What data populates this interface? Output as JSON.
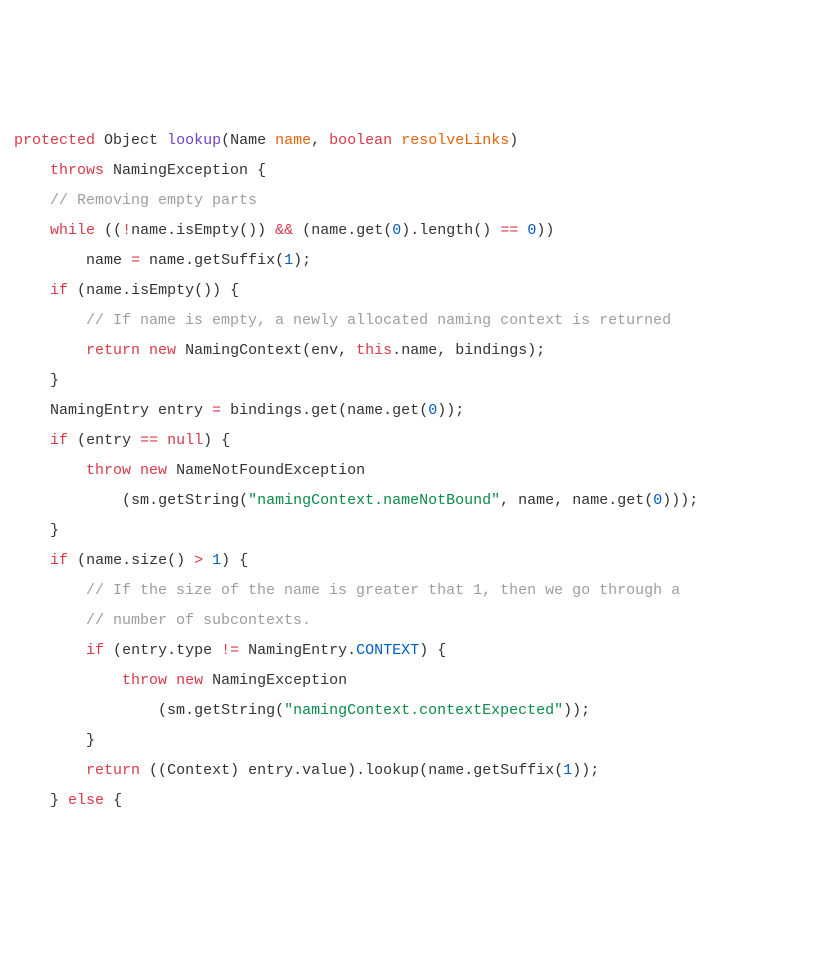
{
  "code": {
    "lines": [
      {
        "indent": 0,
        "tokens": [
          {
            "cls": "tok-keyword",
            "t": "protected"
          },
          {
            "cls": "tok-plain",
            "t": " "
          },
          {
            "cls": "tok-type",
            "t": "Object"
          },
          {
            "cls": "tok-plain",
            "t": " "
          },
          {
            "cls": "tok-methoddef",
            "t": "lookup"
          },
          {
            "cls": "tok-punct",
            "t": "("
          },
          {
            "cls": "tok-type",
            "t": "Name"
          },
          {
            "cls": "tok-plain",
            "t": " "
          },
          {
            "cls": "tok-param",
            "t": "name"
          },
          {
            "cls": "tok-punct",
            "t": ", "
          },
          {
            "cls": "tok-keyword",
            "t": "boolean"
          },
          {
            "cls": "tok-plain",
            "t": " "
          },
          {
            "cls": "tok-param",
            "t": "resolveLinks"
          },
          {
            "cls": "tok-punct",
            "t": ")"
          }
        ]
      },
      {
        "indent": 1,
        "tokens": [
          {
            "cls": "tok-keyword",
            "t": "throws"
          },
          {
            "cls": "tok-plain",
            "t": " NamingException "
          },
          {
            "cls": "tok-punct",
            "t": "{"
          }
        ]
      },
      {
        "indent": 0,
        "tokens": [
          {
            "cls": "tok-plain",
            "t": ""
          }
        ]
      },
      {
        "indent": 1,
        "tokens": [
          {
            "cls": "tok-comment",
            "t": "// Removing empty parts"
          }
        ]
      },
      {
        "indent": 1,
        "tokens": [
          {
            "cls": "tok-keyword",
            "t": "while"
          },
          {
            "cls": "tok-plain",
            "t": " "
          },
          {
            "cls": "tok-punct",
            "t": "(("
          },
          {
            "cls": "tok-op",
            "t": "!"
          },
          {
            "cls": "tok-plain",
            "t": "name"
          },
          {
            "cls": "tok-punct",
            "t": "."
          },
          {
            "cls": "tok-callmethod",
            "t": "isEmpty"
          },
          {
            "cls": "tok-punct",
            "t": "()) "
          },
          {
            "cls": "tok-op",
            "t": "&&"
          },
          {
            "cls": "tok-plain",
            "t": " "
          },
          {
            "cls": "tok-punct",
            "t": "("
          },
          {
            "cls": "tok-plain",
            "t": "name"
          },
          {
            "cls": "tok-punct",
            "t": "."
          },
          {
            "cls": "tok-callmethod",
            "t": "get"
          },
          {
            "cls": "tok-punct",
            "t": "("
          },
          {
            "cls": "tok-number",
            "t": "0"
          },
          {
            "cls": "tok-punct",
            "t": ")."
          },
          {
            "cls": "tok-callmethod",
            "t": "length"
          },
          {
            "cls": "tok-punct",
            "t": "() "
          },
          {
            "cls": "tok-op",
            "t": "=="
          },
          {
            "cls": "tok-plain",
            "t": " "
          },
          {
            "cls": "tok-number",
            "t": "0"
          },
          {
            "cls": "tok-punct",
            "t": "))"
          }
        ]
      },
      {
        "indent": 2,
        "tokens": [
          {
            "cls": "tok-plain",
            "t": "name "
          },
          {
            "cls": "tok-op",
            "t": "="
          },
          {
            "cls": "tok-plain",
            "t": " name"
          },
          {
            "cls": "tok-punct",
            "t": "."
          },
          {
            "cls": "tok-callmethod",
            "t": "getSuffix"
          },
          {
            "cls": "tok-punct",
            "t": "("
          },
          {
            "cls": "tok-number",
            "t": "1"
          },
          {
            "cls": "tok-punct",
            "t": ");"
          }
        ]
      },
      {
        "indent": 1,
        "tokens": [
          {
            "cls": "tok-keyword",
            "t": "if"
          },
          {
            "cls": "tok-plain",
            "t": " "
          },
          {
            "cls": "tok-punct",
            "t": "("
          },
          {
            "cls": "tok-plain",
            "t": "name"
          },
          {
            "cls": "tok-punct",
            "t": "."
          },
          {
            "cls": "tok-callmethod",
            "t": "isEmpty"
          },
          {
            "cls": "tok-punct",
            "t": "()) {"
          }
        ]
      },
      {
        "indent": 2,
        "tokens": [
          {
            "cls": "tok-comment",
            "t": "// If name is empty, a newly allocated naming context is returned"
          }
        ]
      },
      {
        "indent": 2,
        "tokens": [
          {
            "cls": "tok-keyword",
            "t": "return"
          },
          {
            "cls": "tok-plain",
            "t": " "
          },
          {
            "cls": "tok-keyword",
            "t": "new"
          },
          {
            "cls": "tok-plain",
            "t": " "
          },
          {
            "cls": "tok-callmethod",
            "t": "NamingContext"
          },
          {
            "cls": "tok-punct",
            "t": "("
          },
          {
            "cls": "tok-plain",
            "t": "env"
          },
          {
            "cls": "tok-punct",
            "t": ", "
          },
          {
            "cls": "tok-keyword",
            "t": "this"
          },
          {
            "cls": "tok-punct",
            "t": "."
          },
          {
            "cls": "tok-plain",
            "t": "name"
          },
          {
            "cls": "tok-punct",
            "t": ", "
          },
          {
            "cls": "tok-plain",
            "t": "bindings"
          },
          {
            "cls": "tok-punct",
            "t": ");"
          }
        ]
      },
      {
        "indent": 1,
        "tokens": [
          {
            "cls": "tok-punct",
            "t": "}"
          }
        ]
      },
      {
        "indent": 0,
        "tokens": [
          {
            "cls": "tok-plain",
            "t": ""
          }
        ]
      },
      {
        "indent": 1,
        "tokens": [
          {
            "cls": "tok-type",
            "t": "NamingEntry"
          },
          {
            "cls": "tok-plain",
            "t": " entry "
          },
          {
            "cls": "tok-op",
            "t": "="
          },
          {
            "cls": "tok-plain",
            "t": " bindings"
          },
          {
            "cls": "tok-punct",
            "t": "."
          },
          {
            "cls": "tok-callmethod",
            "t": "get"
          },
          {
            "cls": "tok-punct",
            "t": "("
          },
          {
            "cls": "tok-plain",
            "t": "name"
          },
          {
            "cls": "tok-punct",
            "t": "."
          },
          {
            "cls": "tok-callmethod",
            "t": "get"
          },
          {
            "cls": "tok-punct",
            "t": "("
          },
          {
            "cls": "tok-number",
            "t": "0"
          },
          {
            "cls": "tok-punct",
            "t": "));"
          }
        ]
      },
      {
        "indent": 0,
        "tokens": [
          {
            "cls": "tok-plain",
            "t": ""
          }
        ]
      },
      {
        "indent": 1,
        "tokens": [
          {
            "cls": "tok-keyword",
            "t": "if"
          },
          {
            "cls": "tok-plain",
            "t": " "
          },
          {
            "cls": "tok-punct",
            "t": "("
          },
          {
            "cls": "tok-plain",
            "t": "entry "
          },
          {
            "cls": "tok-op",
            "t": "=="
          },
          {
            "cls": "tok-plain",
            "t": " "
          },
          {
            "cls": "tok-keyword",
            "t": "null"
          },
          {
            "cls": "tok-punct",
            "t": ") {"
          }
        ]
      },
      {
        "indent": 2,
        "tokens": [
          {
            "cls": "tok-keyword",
            "t": "throw"
          },
          {
            "cls": "tok-plain",
            "t": " "
          },
          {
            "cls": "tok-keyword",
            "t": "new"
          },
          {
            "cls": "tok-plain",
            "t": " "
          },
          {
            "cls": "tok-callmethod",
            "t": "NameNotFoundException"
          }
        ]
      },
      {
        "indent": 3,
        "tokens": [
          {
            "cls": "tok-punct",
            "t": "("
          },
          {
            "cls": "tok-plain",
            "t": "sm"
          },
          {
            "cls": "tok-punct",
            "t": "."
          },
          {
            "cls": "tok-callmethod",
            "t": "getString"
          },
          {
            "cls": "tok-punct",
            "t": "("
          },
          {
            "cls": "tok-string",
            "t": "\"namingContext.nameNotBound\""
          },
          {
            "cls": "tok-punct",
            "t": ", "
          },
          {
            "cls": "tok-plain",
            "t": "name"
          },
          {
            "cls": "tok-punct",
            "t": ", "
          },
          {
            "cls": "tok-plain",
            "t": "name"
          },
          {
            "cls": "tok-punct",
            "t": "."
          },
          {
            "cls": "tok-callmethod",
            "t": "get"
          },
          {
            "cls": "tok-punct",
            "t": "("
          },
          {
            "cls": "tok-number",
            "t": "0"
          },
          {
            "cls": "tok-punct",
            "t": ")));"
          }
        ]
      },
      {
        "indent": 1,
        "tokens": [
          {
            "cls": "tok-punct",
            "t": "}"
          }
        ]
      },
      {
        "indent": 0,
        "tokens": [
          {
            "cls": "tok-plain",
            "t": ""
          }
        ]
      },
      {
        "indent": 1,
        "tokens": [
          {
            "cls": "tok-keyword",
            "t": "if"
          },
          {
            "cls": "tok-plain",
            "t": " "
          },
          {
            "cls": "tok-punct",
            "t": "("
          },
          {
            "cls": "tok-plain",
            "t": "name"
          },
          {
            "cls": "tok-punct",
            "t": "."
          },
          {
            "cls": "tok-callmethod",
            "t": "size"
          },
          {
            "cls": "tok-punct",
            "t": "() "
          },
          {
            "cls": "tok-op",
            "t": ">"
          },
          {
            "cls": "tok-plain",
            "t": " "
          },
          {
            "cls": "tok-number",
            "t": "1"
          },
          {
            "cls": "tok-punct",
            "t": ") {"
          }
        ]
      },
      {
        "indent": 2,
        "tokens": [
          {
            "cls": "tok-comment",
            "t": "// If the size of the name is greater that 1, then we go through a"
          }
        ]
      },
      {
        "indent": 2,
        "tokens": [
          {
            "cls": "tok-comment",
            "t": "// number of subcontexts."
          }
        ]
      },
      {
        "indent": 2,
        "tokens": [
          {
            "cls": "tok-keyword",
            "t": "if"
          },
          {
            "cls": "tok-plain",
            "t": " "
          },
          {
            "cls": "tok-punct",
            "t": "("
          },
          {
            "cls": "tok-plain",
            "t": "entry"
          },
          {
            "cls": "tok-punct",
            "t": "."
          },
          {
            "cls": "tok-plain",
            "t": "type "
          },
          {
            "cls": "tok-op",
            "t": "!="
          },
          {
            "cls": "tok-plain",
            "t": " NamingEntry"
          },
          {
            "cls": "tok-punct",
            "t": "."
          },
          {
            "cls": "tok-constant",
            "t": "CONTEXT"
          },
          {
            "cls": "tok-punct",
            "t": ") {"
          }
        ]
      },
      {
        "indent": 3,
        "tokens": [
          {
            "cls": "tok-keyword",
            "t": "throw"
          },
          {
            "cls": "tok-plain",
            "t": " "
          },
          {
            "cls": "tok-keyword",
            "t": "new"
          },
          {
            "cls": "tok-plain",
            "t": " "
          },
          {
            "cls": "tok-callmethod",
            "t": "NamingException"
          }
        ]
      },
      {
        "indent": 4,
        "tokens": [
          {
            "cls": "tok-punct",
            "t": "("
          },
          {
            "cls": "tok-plain",
            "t": "sm"
          },
          {
            "cls": "tok-punct",
            "t": "."
          },
          {
            "cls": "tok-callmethod",
            "t": "getString"
          },
          {
            "cls": "tok-punct",
            "t": "("
          },
          {
            "cls": "tok-string",
            "t": "\"namingContext.contextExpected\""
          },
          {
            "cls": "tok-punct",
            "t": "));"
          }
        ]
      },
      {
        "indent": 2,
        "tokens": [
          {
            "cls": "tok-punct",
            "t": "}"
          }
        ]
      },
      {
        "indent": 2,
        "tokens": [
          {
            "cls": "tok-keyword",
            "t": "return"
          },
          {
            "cls": "tok-plain",
            "t": " "
          },
          {
            "cls": "tok-punct",
            "t": "(("
          },
          {
            "cls": "tok-type",
            "t": "Context"
          },
          {
            "cls": "tok-punct",
            "t": ") "
          },
          {
            "cls": "tok-plain",
            "t": "entry"
          },
          {
            "cls": "tok-punct",
            "t": "."
          },
          {
            "cls": "tok-plain",
            "t": "value"
          },
          {
            "cls": "tok-punct",
            "t": ")."
          },
          {
            "cls": "tok-callmethod",
            "t": "lookup"
          },
          {
            "cls": "tok-punct",
            "t": "("
          },
          {
            "cls": "tok-plain",
            "t": "name"
          },
          {
            "cls": "tok-punct",
            "t": "."
          },
          {
            "cls": "tok-callmethod",
            "t": "getSuffix"
          },
          {
            "cls": "tok-punct",
            "t": "("
          },
          {
            "cls": "tok-number",
            "t": "1"
          },
          {
            "cls": "tok-punct",
            "t": "));"
          }
        ]
      },
      {
        "indent": 1,
        "tokens": [
          {
            "cls": "tok-punct",
            "t": "} "
          },
          {
            "cls": "tok-keyword",
            "t": "else"
          },
          {
            "cls": "tok-plain",
            "t": " "
          },
          {
            "cls": "tok-punct",
            "t": "{"
          }
        ]
      }
    ]
  },
  "indent_unit": "    "
}
